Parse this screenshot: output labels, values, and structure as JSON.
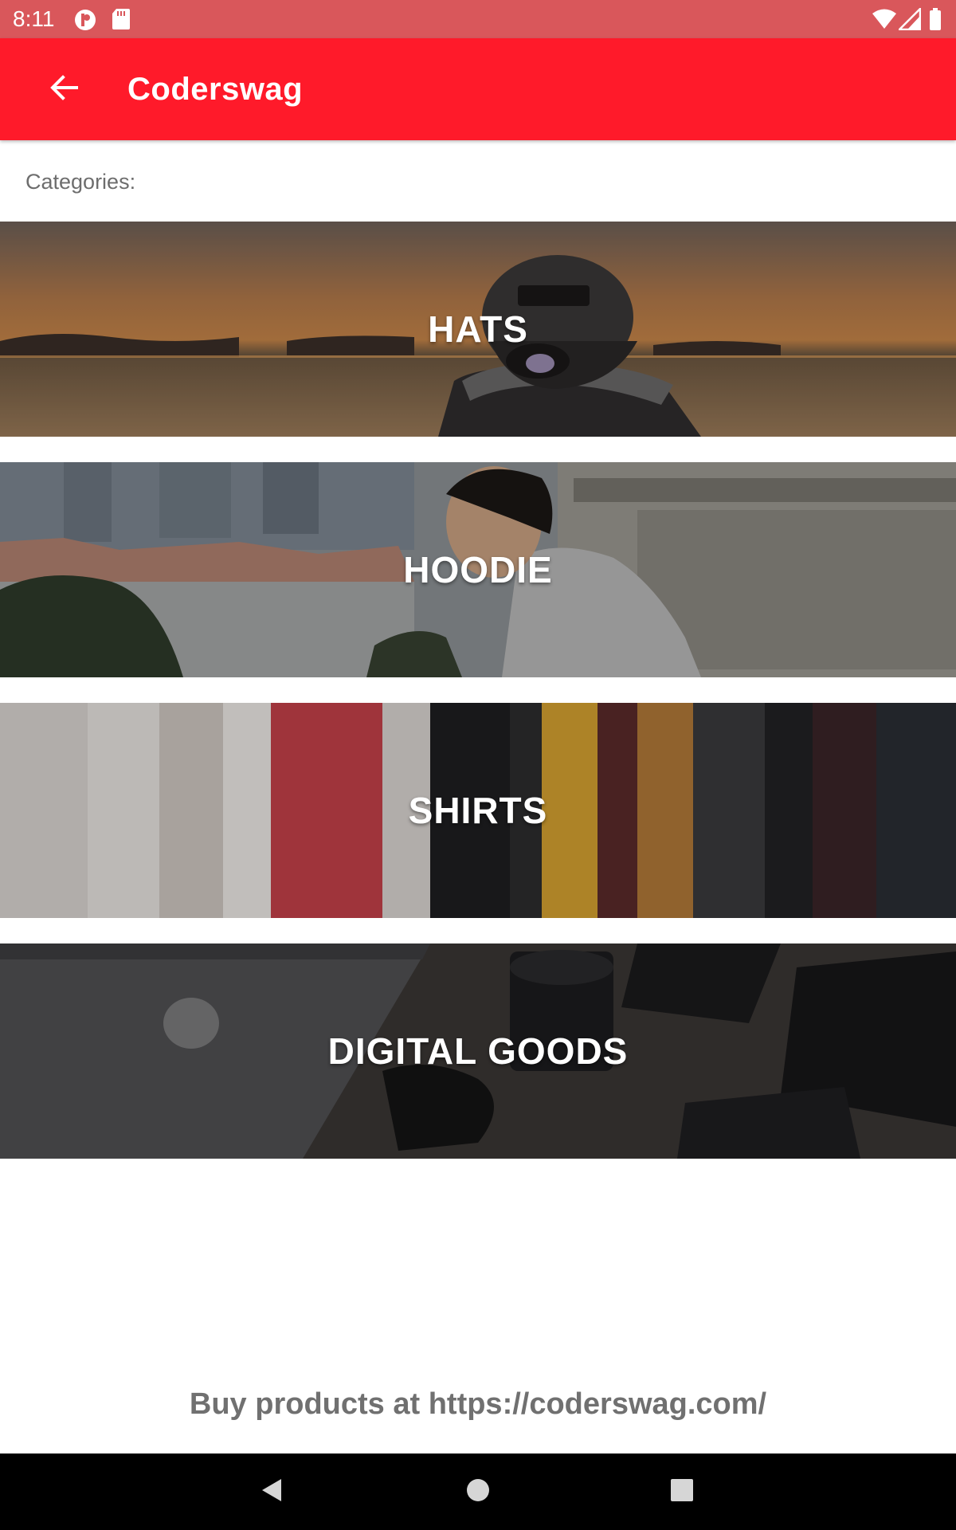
{
  "status_bar": {
    "time": "8:11",
    "icons": [
      "notification-icon",
      "sd-card-icon",
      "wifi-icon",
      "signal-icon",
      "battery-icon"
    ]
  },
  "app_bar": {
    "title": "Coderswag",
    "back_icon": "arrow-back-icon"
  },
  "main": {
    "categories_label": "Categories:",
    "categories": [
      {
        "label": "HATS"
      },
      {
        "label": "HOODIE"
      },
      {
        "label": "SHIRTS"
      },
      {
        "label": "DIGITAL GOODS"
      }
    ],
    "footer": "Buy products at https://coderswag.com/"
  },
  "nav_bar": {
    "buttons": [
      "back-triangle-icon",
      "home-circle-icon",
      "recents-square-icon"
    ]
  },
  "colors": {
    "status_bar": "#d9575b",
    "app_bar": "#ff1a2a",
    "footer_text": "#707070",
    "label_text": "#6d6d6d"
  }
}
